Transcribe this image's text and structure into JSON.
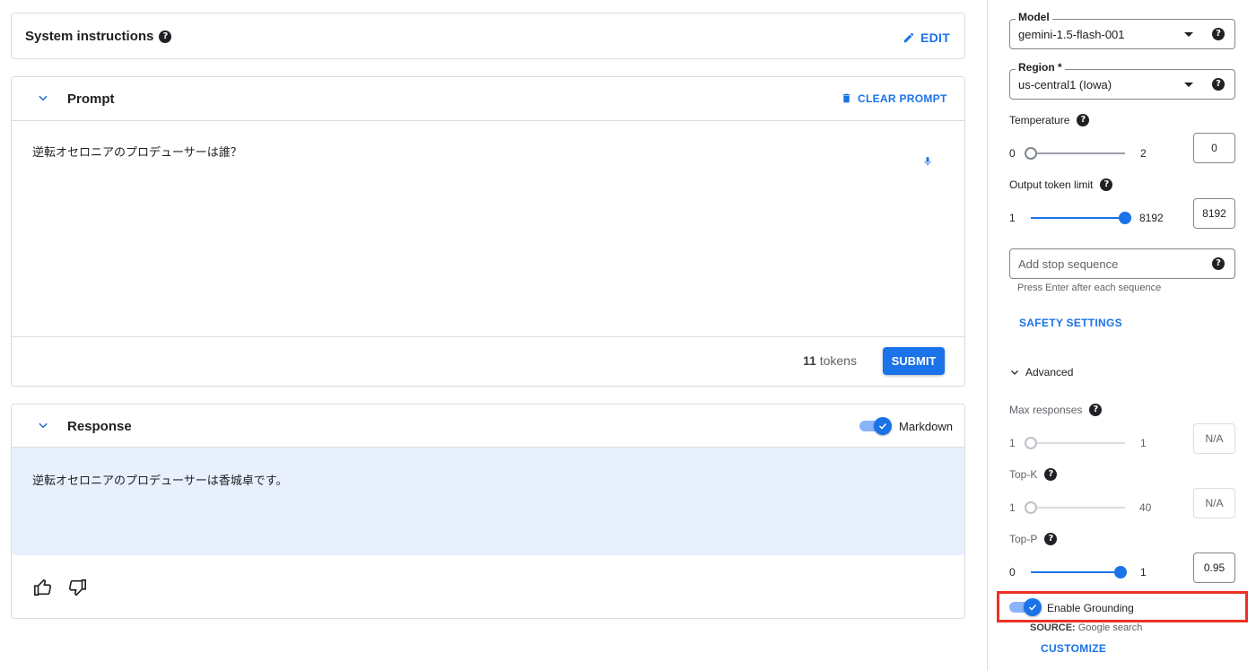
{
  "system": {
    "title": "System instructions",
    "edit_label": "EDIT"
  },
  "prompt": {
    "title": "Prompt",
    "clear_label": "CLEAR PROMPT",
    "text": "逆転オセロニアのプロデューサーは誰？",
    "tokens_count": "11",
    "tokens_label": "tokens",
    "submit_label": "SUBMIT"
  },
  "response": {
    "title": "Response",
    "markdown_label": "Markdown",
    "markdown_enabled": true,
    "text": "逆転オセロニアのプロデューサーは香城卓です。"
  },
  "settings": {
    "model": {
      "label": "Model",
      "value": "gemini-1.5-flash-001"
    },
    "region": {
      "label": "Region *",
      "value": "us-central1 (Iowa)"
    },
    "temperature": {
      "label": "Temperature",
      "min": "0",
      "max": "2",
      "value": "0",
      "fraction": 0
    },
    "output_token_limit": {
      "label": "Output token limit",
      "min": "1",
      "max": "8192",
      "value": "8192",
      "fraction": 1
    },
    "stop_sequence": {
      "placeholder": "Add stop sequence",
      "hint": "Press Enter after each sequence"
    },
    "safety_settings_label": "SAFETY SETTINGS",
    "advanced_label": "Advanced",
    "max_responses": {
      "label": "Max responses",
      "min": "1",
      "max": "1",
      "value": "N/A",
      "fraction": 0
    },
    "top_k": {
      "label": "Top-K",
      "min": "1",
      "max": "40",
      "value": "N/A",
      "fraction": 0
    },
    "top_p": {
      "label": "Top-P",
      "min": "0",
      "max": "1",
      "value": "0.95",
      "fraction": 0.95
    },
    "grounding": {
      "label": "Enable Grounding",
      "enabled": true,
      "source_key": "SOURCE:",
      "source_value": "Google search",
      "customize_label": "CUSTOMIZE"
    }
  },
  "colors": {
    "accent": "#1a73e8",
    "highlight": "#ee3124",
    "response_bg": "#e8f0fe"
  }
}
